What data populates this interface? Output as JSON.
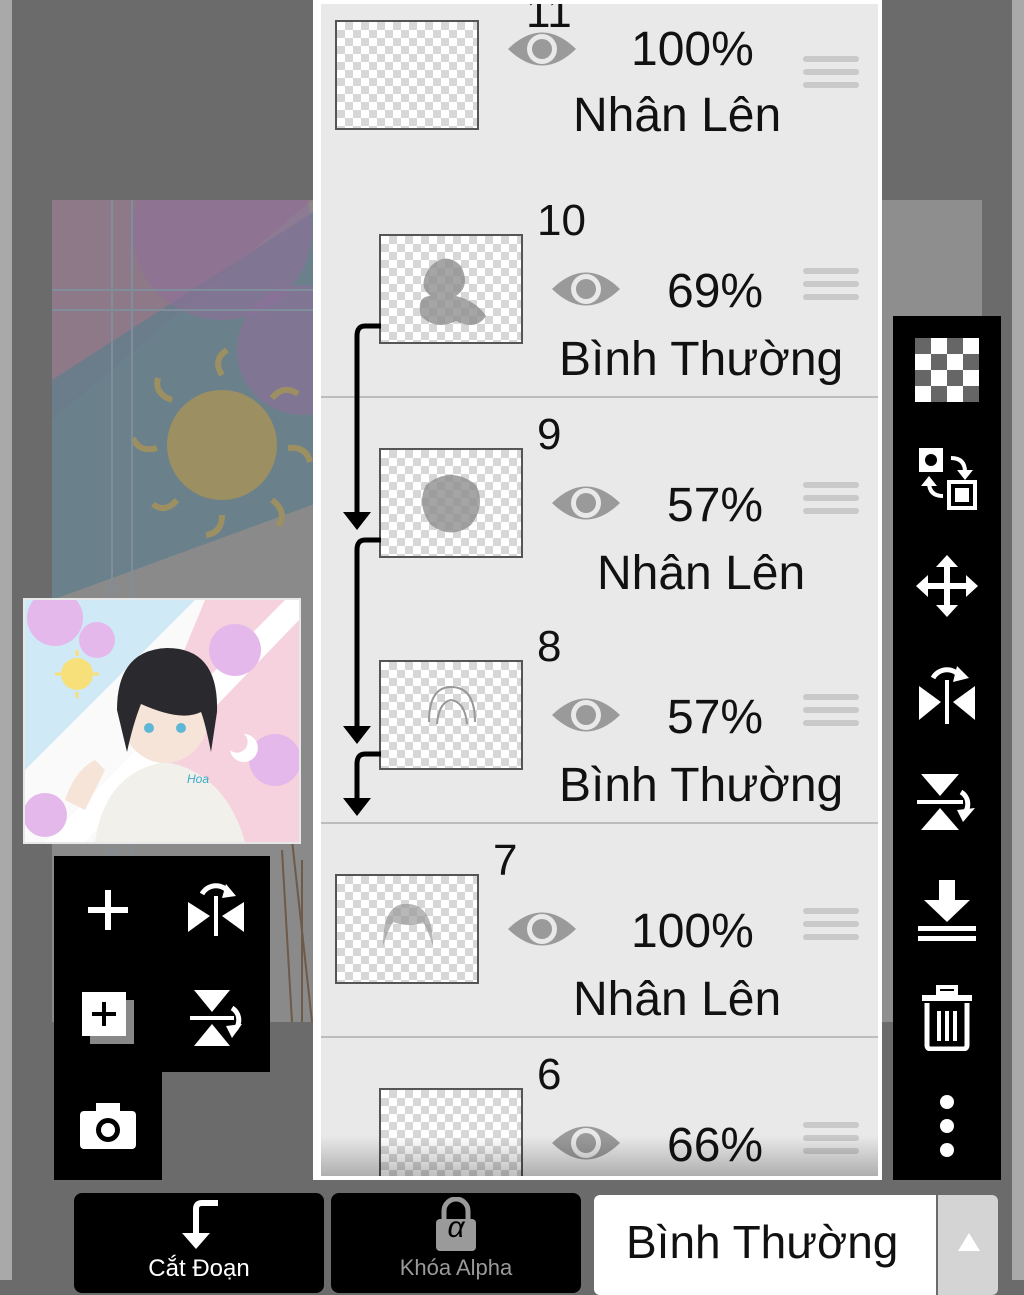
{
  "layers": [
    {
      "number": "11",
      "opacity": "100%",
      "blend": "Nhân Lên"
    },
    {
      "number": "10",
      "opacity": "69%",
      "blend": "Bình Thường"
    },
    {
      "number": "9",
      "opacity": "57%",
      "blend": "Nhân Lên"
    },
    {
      "number": "8",
      "opacity": "57%",
      "blend": "Bình Thường"
    },
    {
      "number": "7",
      "opacity": "100%",
      "blend": "Nhân Lên"
    },
    {
      "number": "6",
      "opacity": "66%",
      "blend": ""
    }
  ],
  "bottom_bar": {
    "clip_label": "Cắt Đoạn",
    "alpha_lock_label": "Khóa Alpha",
    "alpha_symbol": "α",
    "blend_mode_value": "Bình Thường"
  },
  "right_toolbar": [
    "transparency-icon",
    "swap-layers-icon",
    "move-icon",
    "flip-horizontal-icon",
    "flip-vertical-icon",
    "merge-down-icon",
    "delete-icon",
    "more-icon"
  ],
  "left_toolbar": [
    "add-layer-icon",
    "flip-horizontal-icon",
    "add-copy-icon",
    "flip-vertical-icon",
    "camera-icon"
  ],
  "preview_signature": "Hoa"
}
